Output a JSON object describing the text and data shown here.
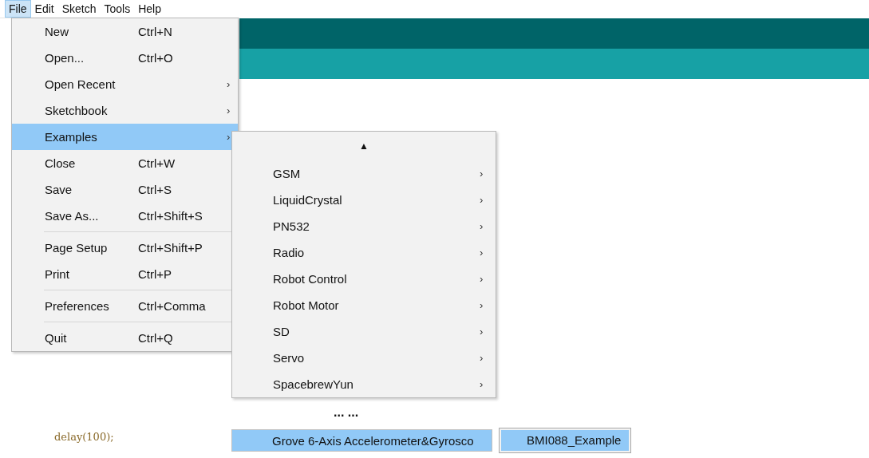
{
  "menubar": [
    {
      "label": "File",
      "selected": true
    },
    {
      "label": "Edit",
      "selected": false
    },
    {
      "label": "Sketch",
      "selected": false
    },
    {
      "label": "Tools",
      "selected": false
    },
    {
      "label": "Help",
      "selected": false
    }
  ],
  "file_menu": {
    "groups": [
      [
        {
          "label": "New",
          "shortcut": "Ctrl+N",
          "selected": false
        },
        {
          "label": "Open...",
          "shortcut": "Ctrl+O",
          "selected": false
        },
        {
          "label": "Open Recent",
          "arrow": "›",
          "selected": false
        },
        {
          "label": "Sketchbook",
          "arrow": "›",
          "selected": false
        },
        {
          "label": "Examples",
          "arrow": "›",
          "selected": true
        },
        {
          "label": "Close",
          "shortcut": "Ctrl+W",
          "selected": false
        },
        {
          "label": "Save",
          "shortcut": "Ctrl+S",
          "selected": false
        },
        {
          "label": "Save As...",
          "shortcut": "Ctrl+Shift+S",
          "selected": false
        }
      ],
      [
        {
          "label": "Page Setup",
          "shortcut": "Ctrl+Shift+P",
          "selected": false
        },
        {
          "label": "Print",
          "shortcut": "Ctrl+P",
          "selected": false
        }
      ],
      [
        {
          "label": "Preferences",
          "shortcut": "Ctrl+Comma",
          "selected": false
        }
      ],
      [
        {
          "label": "Quit",
          "shortcut": "Ctrl+Q",
          "selected": false
        }
      ]
    ]
  },
  "examples_menu": {
    "scroll_up": "▲",
    "items": [
      {
        "label": "GSM",
        "arrow": "›",
        "selected": false
      },
      {
        "label": "LiquidCrystal",
        "arrow": "›",
        "selected": false
      },
      {
        "label": "PN532",
        "arrow": "›",
        "selected": false
      },
      {
        "label": "Radio",
        "arrow": "›",
        "selected": false
      },
      {
        "label": "Robot Control",
        "arrow": "›",
        "selected": false
      },
      {
        "label": "Robot Motor",
        "arrow": "›",
        "selected": false
      },
      {
        "label": "SD",
        "arrow": "›",
        "selected": false
      },
      {
        "label": "Servo",
        "arrow": "›",
        "selected": false
      },
      {
        "label": "SpacebrewYun",
        "arrow": "›",
        "selected": false
      }
    ]
  },
  "gap_text": "... ...",
  "code_line": "delay(100);",
  "library_item": {
    "label": "Grove 6-Axis Accelerometer&Gyrosco",
    "selected": true
  },
  "example_item": {
    "label": "BMI088_Example",
    "selected": true
  }
}
